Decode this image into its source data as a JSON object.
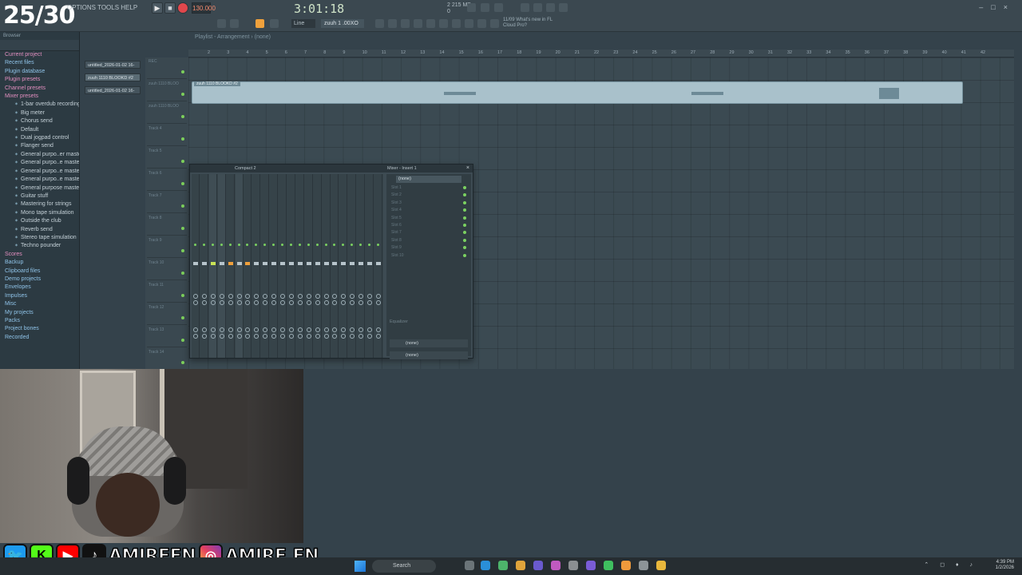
{
  "overlay": {
    "counter": "25/30"
  },
  "toolbar": {
    "menu": "OPTIONS TOOLS HELP",
    "tempo": "130.000",
    "time": "3:01:18",
    "cpu": "2 215 MB\n0",
    "snap": "Line",
    "pattern": "zuuh 1 .00XO",
    "news": "11/09 What's new in FL\nCloud Pro?",
    "window_controls": "–□×"
  },
  "browser": {
    "title": "Browser",
    "items": [
      {
        "label": "Current project",
        "kind": "folder-pink"
      },
      {
        "label": "Recent files",
        "kind": "folder"
      },
      {
        "label": "Plugin database",
        "kind": "folder"
      },
      {
        "label": "Plugin presets",
        "kind": "folder-pink"
      },
      {
        "label": "Channel presets",
        "kind": "folder-pink"
      },
      {
        "label": "Mixer presets",
        "kind": "folder-pink"
      },
      {
        "label": "1-bar overdub recording",
        "kind": "sub"
      },
      {
        "label": "Big meter",
        "kind": "sub"
      },
      {
        "label": "Chorus send",
        "kind": "sub"
      },
      {
        "label": "Default",
        "kind": "sub"
      },
      {
        "label": "Dual jogpad control",
        "kind": "sub"
      },
      {
        "label": "Flanger send",
        "kind": "sub"
      },
      {
        "label": "General purpo..er mastering",
        "kind": "sub"
      },
      {
        "label": "General purpo..e mastering 2",
        "kind": "sub"
      },
      {
        "label": "General purpo..e mastering 3",
        "kind": "sub"
      },
      {
        "label": "General purpo..e mastering 4",
        "kind": "sub"
      },
      {
        "label": "General purpose mastering",
        "kind": "sub"
      },
      {
        "label": "Guitar stuff",
        "kind": "sub"
      },
      {
        "label": "Mastering for strings",
        "kind": "sub"
      },
      {
        "label": "Mono tape simulation",
        "kind": "sub"
      },
      {
        "label": "Outside the club",
        "kind": "sub"
      },
      {
        "label": "Reverb send",
        "kind": "sub"
      },
      {
        "label": "Stereo tape simulation",
        "kind": "sub"
      },
      {
        "label": "Techno pounder",
        "kind": "sub"
      },
      {
        "label": "Scores",
        "kind": "folder-pink"
      },
      {
        "label": "Backup",
        "kind": "folder"
      },
      {
        "label": "Clipboard files",
        "kind": "folder"
      },
      {
        "label": "Demo projects",
        "kind": "folder"
      },
      {
        "label": "Envelopes",
        "kind": "folder"
      },
      {
        "label": "Impulses",
        "kind": "folder"
      },
      {
        "label": "Misc",
        "kind": "folder"
      },
      {
        "label": "My projects",
        "kind": "folder"
      },
      {
        "label": "Packs",
        "kind": "folder"
      },
      {
        "label": "Project bones",
        "kind": "folder"
      },
      {
        "label": "Recorded",
        "kind": "folder"
      }
    ]
  },
  "picker": {
    "items": [
      "untitled_2026-01-02 16-",
      "zuuh 1110 BLOOKD #2",
      "untitled_2026-01-02 16-"
    ]
  },
  "playlist": {
    "title": "Playlist - Arrangement › (none)",
    "ruler": [
      "2",
      "3",
      "4",
      "5",
      "6",
      "7",
      "8",
      "9",
      "10",
      "11",
      "12",
      "13",
      "14",
      "15",
      "16",
      "17",
      "18",
      "19",
      "20",
      "21",
      "22",
      "23",
      "24",
      "25",
      "26",
      "27",
      "28",
      "29",
      "30",
      "31",
      "32",
      "33",
      "34",
      "35",
      "36",
      "37",
      "38",
      "39",
      "40",
      "41",
      "42"
    ],
    "tracks": [
      "REC",
      "zuuh 1110 BLOO",
      "zuuh 1110 BLOO",
      "Track 4",
      "Track 5",
      "Track 6",
      "Track 7",
      "Track 8",
      "Track 9",
      "Track 10",
      "Track 11",
      "Track 12",
      "Track 13",
      "Track 14"
    ],
    "clip_label": "zuuh 1110 BLOOKD #2"
  },
  "mixer": {
    "title": "Compact 2",
    "insert_title": "Mixer - Insert 1",
    "slot_header": "(none)",
    "slots": [
      "Slot 1",
      "Slot 2",
      "Slot 3",
      "Slot 4",
      "Slot 5",
      "Slot 6",
      "Slot 7",
      "Slot 8",
      "Slot 9",
      "Slot 10"
    ],
    "eq_label": "Equalizer",
    "send_in": "(none)",
    "send_out": "(none)"
  },
  "social": {
    "handle_1": "AMIREFN",
    "handle_2": "AMIRE.FN"
  },
  "taskbar": {
    "search": "Search",
    "time": "4:39 PM",
    "date": "1/2/2026"
  }
}
